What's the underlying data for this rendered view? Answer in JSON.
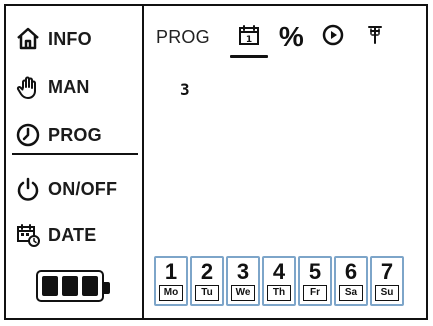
{
  "sidebar": {
    "items": [
      {
        "label": "INFO",
        "icon": "home-icon"
      },
      {
        "label": "MAN",
        "icon": "hand-icon"
      },
      {
        "label": "PROG",
        "icon": "clock-icon"
      },
      {
        "label": "ON/OFF",
        "icon": "power-icon"
      },
      {
        "label": "DATE",
        "icon": "calendar-clock-icon"
      }
    ],
    "battery": {
      "bars": 3,
      "icon": "battery-icon"
    }
  },
  "main": {
    "header": {
      "title": "PROG",
      "calendar_icon_label": "1",
      "percent_label": "%"
    },
    "program_digit": "3",
    "days": [
      {
        "num": "1",
        "abbr": "Mo"
      },
      {
        "num": "2",
        "abbr": "Tu"
      },
      {
        "num": "3",
        "abbr": "We"
      },
      {
        "num": "4",
        "abbr": "Th"
      },
      {
        "num": "5",
        "abbr": "Fr"
      },
      {
        "num": "6",
        "abbr": "Sa"
      },
      {
        "num": "7",
        "abbr": "Su"
      }
    ],
    "day_box_color": "#7da5c9"
  }
}
